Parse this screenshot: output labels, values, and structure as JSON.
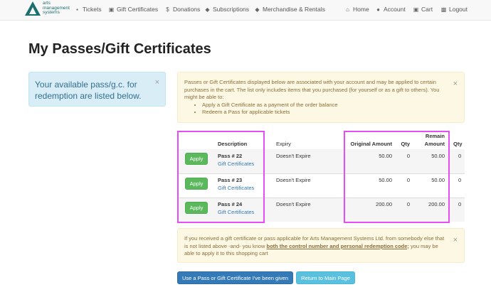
{
  "brand": {
    "line1": "arts",
    "line2": "management",
    "line3": "systems"
  },
  "nav": {
    "tickets": "Tickets",
    "gift_certificates": "Gift Certificates",
    "donations": "Donations",
    "subscriptions": "Subscriptions",
    "merchandise": "Merchandise & Rentals",
    "home": "Home",
    "account": "Account",
    "cart": "Cart",
    "logout": "Logout"
  },
  "page_title": "My Passes/Gift Certificates",
  "info_alert": "Your available pass/g.c. for redemption are listed below.",
  "top_warning": {
    "text": "Passes or Gift Certificates displayed below are associated with your account and may be applied to certain purchases in the cart. The list only includes items that you purchased (for yourself or as a gift to others). You might be able to:",
    "bullets": [
      "Apply a Gift Certificate as a payment of the order balance",
      "Redeem a Pass for applicable tickets"
    ]
  },
  "table": {
    "headers": {
      "description": "Description",
      "expiry": "Expiry",
      "original_amount": "Original Amount",
      "qty": "Qty",
      "remain_amount_1": "Remain",
      "remain_amount_2": "Amount",
      "qty2": "Qty"
    },
    "apply_label": "Apply",
    "rows": [
      {
        "pass": "Pass # 22",
        "type": "Gift Certificates",
        "expiry": "Doesn't Expire",
        "original": "50.00",
        "qty": "0",
        "remain": "50.00",
        "qty2": "0"
      },
      {
        "pass": "Pass # 23",
        "type": "Gift Certificates",
        "expiry": "Doesn't Expire",
        "original": "50.00",
        "qty": "0",
        "remain": "50.00",
        "qty2": "0"
      },
      {
        "pass": "Pass # 24",
        "type": "Gift Certificates",
        "expiry": "Doesn't Expire",
        "original": "200.00",
        "qty": "0",
        "remain": "200.00",
        "qty2": "0"
      }
    ]
  },
  "bottom_warning": {
    "part1": "If you received a gift certificate or pass applicable for Arts Management Systems Ltd. from somebody else that is not listed above -and- you know ",
    "emph": "both the control number and personal redemption code;",
    "part2": " you may be able to apply it to this shopping cart"
  },
  "buttons": {
    "use_pass": "Use a Pass or Gift Certificate I've been given",
    "return_main": "Return to Main Page"
  },
  "colors": {
    "highlight": "#e84cf5",
    "apply": "#5cb85c",
    "primary": "#337ab7",
    "info": "#5bc0de"
  }
}
